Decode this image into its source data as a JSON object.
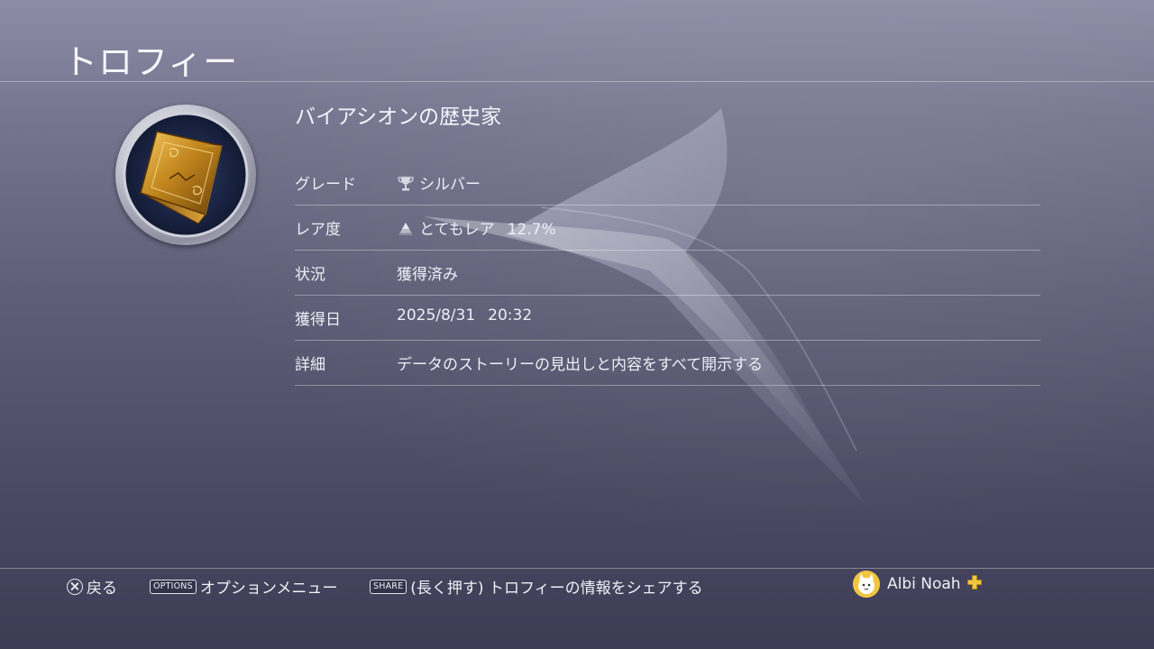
{
  "page": {
    "title": "トロフィー"
  },
  "trophy": {
    "name": "バイアシオンの歴史家",
    "icon": "book-trophy-icon",
    "rows": [
      {
        "key": "grade",
        "label": "グレード",
        "value": "シルバー",
        "icon": "trophy-cup-icon"
      },
      {
        "key": "rarity",
        "label": "レア度",
        "value": "とてもレア",
        "percent": "12.7%",
        "icon": "rarity-pyramid-icon"
      },
      {
        "key": "status",
        "label": "状況",
        "value": "獲得済み"
      },
      {
        "key": "date",
        "label": "獲得日",
        "value": "2025/8/31",
        "time": "20:32"
      },
      {
        "key": "detail",
        "label": "詳細",
        "value": "データのストーリーの見出しと内容をすべて開示する"
      }
    ]
  },
  "footer": {
    "back_label": "戻る",
    "options_key": "OPTIONS",
    "options_label": "オプションメニュー",
    "share_key": "SHARE",
    "share_label": "(長く押す) トロフィーの情報をシェアする",
    "user_name": "Albi Noah"
  },
  "colors": {
    "background_top": "#8d8ca6",
    "background_bottom": "#3d3c55",
    "text": "#f2f3f8",
    "divider": "rgba(255,255,255,0.35)",
    "plus_accent": "#f0c640"
  }
}
